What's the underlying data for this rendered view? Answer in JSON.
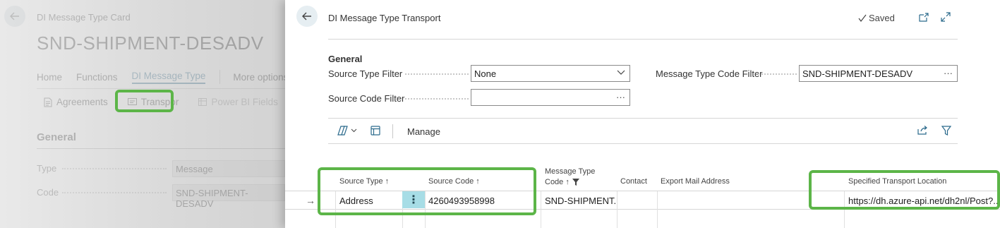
{
  "background_card": {
    "caption": "DI Message Type Card",
    "title": "SND-SHIPMENT-DESADV",
    "nav": [
      "Home",
      "Functions",
      "DI Message Type",
      "More options"
    ],
    "actions": {
      "agreements": "Agreements",
      "transport": "Transpor",
      "power_bi": "Power BI Fields"
    },
    "general_label": "General",
    "fields": [
      {
        "label": "Type",
        "value": "Message"
      },
      {
        "label": "Code",
        "value": "SND-SHIPMENT-DESADV"
      }
    ]
  },
  "dialog": {
    "title": "DI Message Type Transport",
    "saved_label": "Saved",
    "section_label": "General",
    "source_type_filter": {
      "label": "Source Type Filter",
      "value": "None"
    },
    "message_type_code_filter": {
      "label": "Message Type Code Filter",
      "value": "SND-SHIPMENT-DESADV"
    },
    "source_code_filter": {
      "label": "Source Code Filter",
      "value": ""
    },
    "toolbar": {
      "manage_label": "Manage"
    },
    "grid": {
      "headers": {
        "source_type": "Source Type ↑",
        "source_code": "Source Code ↑",
        "message_type_line1": "Message Type",
        "message_type_line2": "Code ↑",
        "contact": "Contact",
        "export_mail": "Export Mail Address",
        "transport_location": "Specified Transport Location"
      },
      "rows": [
        {
          "indicator": "→",
          "source_type": "Address",
          "source_code": "4260493958998",
          "message_type_code": "SND-SHIPMENT...",
          "contact": "",
          "export_mail": "",
          "transport_location": "https://dh.azure-api.net/dh2nl/Post?..."
        }
      ]
    }
  },
  "colors": {
    "highlight": "#5cb548",
    "accent": "#2b6a8c",
    "selected_cell": "#a7dde6"
  },
  "icons": [
    "back-arrow-icon",
    "checkmark-icon",
    "open-new-window-icon",
    "expand-icon",
    "copilot-icon",
    "chevron-down-icon",
    "personalize-icon",
    "share-icon",
    "filter-icon",
    "ellipsis-icon"
  ]
}
